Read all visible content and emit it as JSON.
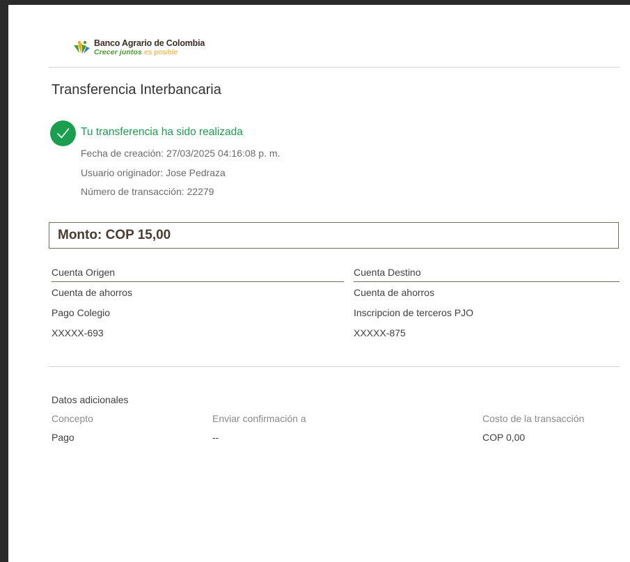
{
  "brand": {
    "name": "Banco Agrario de Colombia",
    "tagline_a": "Crecer juntos",
    "tagline_b": "es posible"
  },
  "document": {
    "title": "Transferencia Interbancaria",
    "status_message": "Tu transferencia ha sido realizada",
    "creation_date": "Fecha de creación: 27/03/2025 04:16:08 p. m.",
    "originator": "Usuario originador: Jose Pedraza",
    "transaction_number": "Número de transacción: 22279",
    "amount_label": "Monto:",
    "amount_value": "COP 15,00"
  },
  "origin_account": {
    "header": "Cuenta Origen",
    "type": "Cuenta de ahorros",
    "name": "Pago Colegio",
    "number": "XXXXX-693"
  },
  "destination_account": {
    "header": "Cuenta Destino",
    "type": "Cuenta de ahorros",
    "name": "Inscripcion de terceros PJO",
    "number": "XXXXX-875"
  },
  "additional": {
    "header": "Datos adicionales",
    "fields": [
      {
        "label": "Concepto",
        "value": "Pago"
      },
      {
        "label": "Enviar confirmación a",
        "value": "--"
      },
      {
        "label": "Costo de la transacción",
        "value": "COP 0,00"
      }
    ]
  },
  "colors": {
    "success": "#1a9f4f",
    "brand_green": "#4a9a2e",
    "brand_yellow": "#f2a81d",
    "brand_brown": "#3b2f27"
  },
  "icons": {
    "logo": "leaves-logo-icon",
    "status": "check-circle-icon"
  }
}
